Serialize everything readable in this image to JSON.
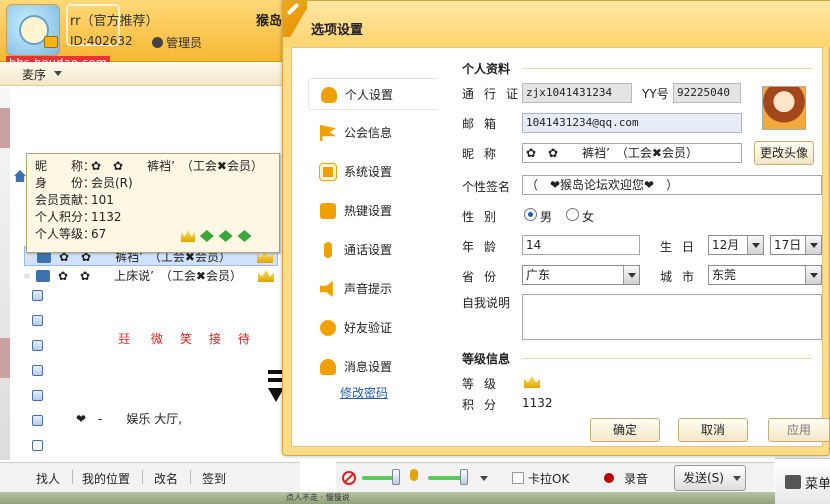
{
  "main": {
    "title": "rr（官方推荐）",
    "hall_title": "猴岛",
    "id_label": "ID:402632",
    "role_label": "管理员",
    "watermark": "bbs.houdao.com",
    "sort_label": "麦序"
  },
  "tooltip": {
    "rows": [
      {
        "key": "昵　　称：",
        "value": "✿　✿　　裤裆’　（工会✖会员）"
      },
      {
        "key": "身　　份：",
        "value": "会员(R)"
      },
      {
        "key": "会员贡献：",
        "value": "101"
      },
      {
        "key": "个人积分：",
        "value": "1132"
      },
      {
        "key": "个人等级：",
        "value": "67"
      }
    ]
  },
  "members": [
    {
      "name": "✿　✿　　裤裆’　（工会✖会员）"
    },
    {
      "name": "✿　✿　　上床说’　（工会✖会员）"
    }
  ],
  "welcome": {
    "mark_left": "㠭",
    "text": "微笑接待",
    "mark_right": "㠭"
  },
  "hall_line": "❤　-　　娱乐 大厅,",
  "bottom_left": {
    "find": "找人",
    "my_pos": "我的位置",
    "rename": "改名",
    "sign_in": "签到"
  },
  "bottom_tools": {
    "karaoke": "卡拉OK",
    "record": "录音",
    "send": "发送(S)"
  },
  "right_panel": {
    "label": "菜单"
  },
  "close_glyph": "✕",
  "bottom_strip_tag": "点人不走 · 慢慢说",
  "dialog": {
    "title": "选项设置",
    "nav": [
      {
        "label": "个人设置",
        "icon": "person-icon"
      },
      {
        "label": "公会信息",
        "icon": "flag-icon"
      },
      {
        "label": "系统设置",
        "icon": "gear-icon"
      },
      {
        "label": "热键设置",
        "icon": "key-icon"
      },
      {
        "label": "通话设置",
        "icon": "mic-icon"
      },
      {
        "label": "声音提示",
        "icon": "speaker-icon"
      },
      {
        "label": "好友验证",
        "icon": "verify-icon"
      },
      {
        "label": "消息设置",
        "icon": "message-icon"
      }
    ],
    "change_password": "修改密码",
    "profile": {
      "section_title": "个人资料",
      "passport_label": "通行证",
      "passport_value": "zjx1041431234",
      "yy_label": "YY号",
      "yy_value": "92225040",
      "email_label": "邮箱",
      "email_value": "1041431234@qq.com",
      "nick_label": "昵称",
      "nick_value": "✿　✿　　裤裆’　（工会✖会员）",
      "change_avatar": "更改头像",
      "signature_label": "个性签名",
      "signature_value": "（　❤猴岛论坛欢迎您❤　）",
      "gender_label": "性别",
      "gender_male": "男",
      "gender_female": "女",
      "gender_selected": "男",
      "age_label": "年龄",
      "age_value": "14",
      "birthday_label": "生日",
      "birth_month": "12月",
      "birth_day": "17日",
      "province_label": "省份",
      "province_value": "广东",
      "city_label": "城市",
      "city_value": "东莞",
      "bio_label": "自我说明",
      "bio_value": ""
    },
    "level": {
      "section_title": "等级信息",
      "grade_label": "等级",
      "points_label": "积分",
      "points_value": "1132"
    },
    "buttons": {
      "ok": "确定",
      "cancel": "取消",
      "apply": "应用"
    }
  }
}
